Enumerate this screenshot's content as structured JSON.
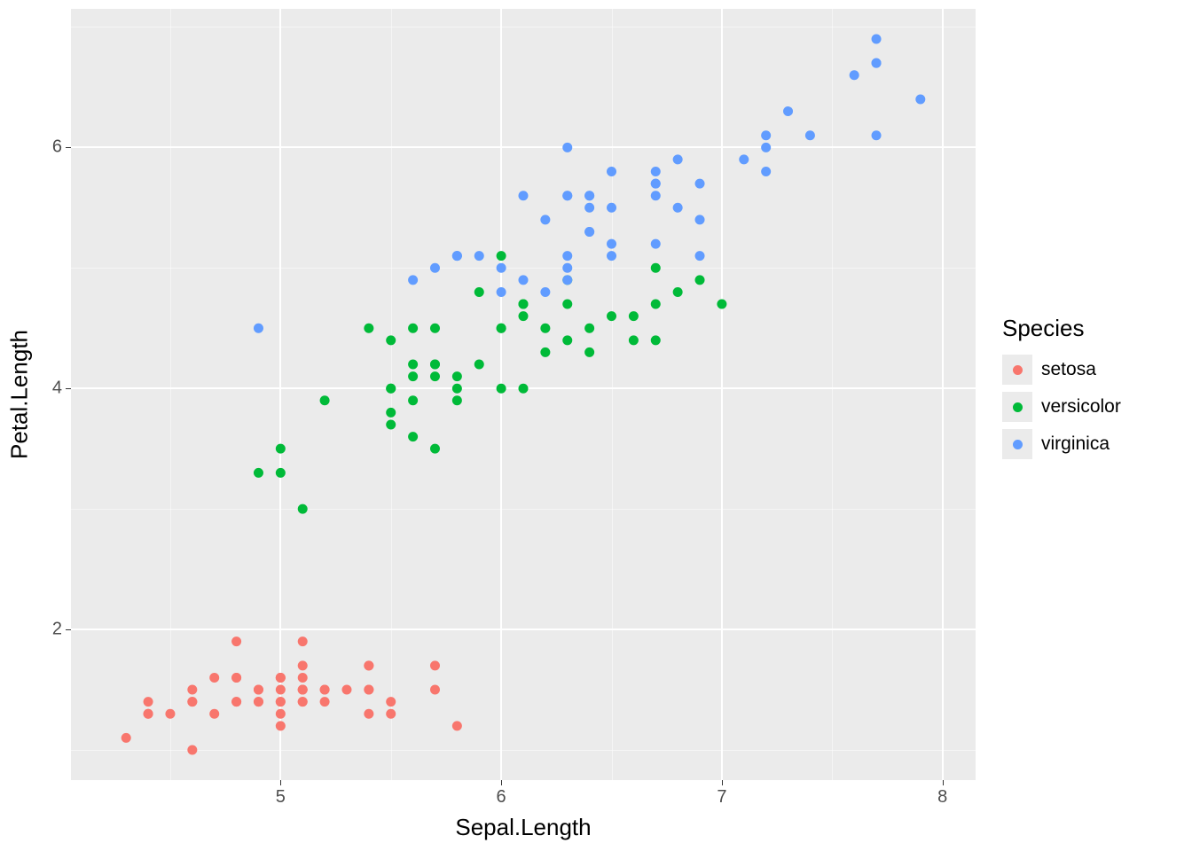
{
  "chart_data": {
    "type": "scatter",
    "xlabel": "Sepal.Length",
    "ylabel": "Petal.Length",
    "xlim": [
      4.05,
      8.15
    ],
    "ylim": [
      0.75,
      7.15
    ],
    "x_breaks": [
      5,
      6,
      7,
      8
    ],
    "y_breaks": [
      2,
      4,
      6
    ],
    "x_minor": [
      4.5,
      5.5,
      6.5,
      7.5
    ],
    "y_minor": [
      1,
      3,
      5,
      7
    ],
    "legend_title": "Species",
    "series": [
      {
        "name": "setosa",
        "color": "#F8766D",
        "points": [
          [
            5.1,
            1.4
          ],
          [
            4.9,
            1.4
          ],
          [
            4.7,
            1.3
          ],
          [
            4.6,
            1.5
          ],
          [
            5.0,
            1.4
          ],
          [
            5.4,
            1.7
          ],
          [
            4.6,
            1.4
          ],
          [
            5.0,
            1.5
          ],
          [
            4.4,
            1.4
          ],
          [
            4.9,
            1.5
          ],
          [
            5.4,
            1.5
          ],
          [
            4.8,
            1.6
          ],
          [
            4.8,
            1.4
          ],
          [
            4.3,
            1.1
          ],
          [
            5.8,
            1.2
          ],
          [
            5.7,
            1.5
          ],
          [
            5.4,
            1.3
          ],
          [
            5.1,
            1.4
          ],
          [
            5.7,
            1.7
          ],
          [
            5.1,
            1.5
          ],
          [
            5.4,
            1.7
          ],
          [
            5.1,
            1.5
          ],
          [
            4.6,
            1.0
          ],
          [
            5.1,
            1.7
          ],
          [
            4.8,
            1.9
          ],
          [
            5.0,
            1.6
          ],
          [
            5.0,
            1.6
          ],
          [
            5.2,
            1.5
          ],
          [
            5.2,
            1.4
          ],
          [
            4.7,
            1.6
          ],
          [
            4.8,
            1.6
          ],
          [
            5.4,
            1.5
          ],
          [
            5.2,
            1.5
          ],
          [
            5.5,
            1.4
          ],
          [
            4.9,
            1.5
          ],
          [
            5.0,
            1.2
          ],
          [
            5.5,
            1.3
          ],
          [
            4.9,
            1.4
          ],
          [
            4.4,
            1.3
          ],
          [
            5.1,
            1.5
          ],
          [
            5.0,
            1.3
          ],
          [
            4.5,
            1.3
          ],
          [
            4.4,
            1.3
          ],
          [
            5.0,
            1.6
          ],
          [
            5.1,
            1.9
          ],
          [
            4.8,
            1.4
          ],
          [
            5.1,
            1.6
          ],
          [
            4.6,
            1.4
          ],
          [
            5.3,
            1.5
          ],
          [
            5.0,
            1.4
          ]
        ]
      },
      {
        "name": "versicolor",
        "color": "#00BA38",
        "points": [
          [
            7.0,
            4.7
          ],
          [
            6.4,
            4.5
          ],
          [
            6.9,
            4.9
          ],
          [
            5.5,
            4.0
          ],
          [
            6.5,
            4.6
          ],
          [
            5.7,
            4.5
          ],
          [
            6.3,
            4.7
          ],
          [
            4.9,
            3.3
          ],
          [
            6.6,
            4.6
          ],
          [
            5.2,
            3.9
          ],
          [
            5.0,
            3.5
          ],
          [
            5.9,
            4.2
          ],
          [
            6.0,
            4.0
          ],
          [
            6.1,
            4.7
          ],
          [
            5.6,
            3.6
          ],
          [
            6.7,
            4.4
          ],
          [
            5.6,
            4.5
          ],
          [
            5.8,
            4.1
          ],
          [
            6.2,
            4.5
          ],
          [
            5.6,
            3.9
          ],
          [
            5.9,
            4.8
          ],
          [
            6.1,
            4.0
          ],
          [
            6.3,
            4.9
          ],
          [
            6.1,
            4.7
          ],
          [
            6.4,
            4.3
          ],
          [
            6.6,
            4.4
          ],
          [
            6.8,
            4.8
          ],
          [
            6.7,
            5.0
          ],
          [
            6.0,
            4.5
          ],
          [
            5.7,
            3.5
          ],
          [
            5.5,
            3.8
          ],
          [
            5.5,
            3.7
          ],
          [
            5.8,
            3.9
          ],
          [
            6.0,
            5.1
          ],
          [
            5.4,
            4.5
          ],
          [
            6.0,
            4.5
          ],
          [
            6.7,
            4.7
          ],
          [
            6.3,
            4.4
          ],
          [
            5.6,
            4.1
          ],
          [
            5.5,
            4.0
          ],
          [
            5.5,
            4.4
          ],
          [
            6.1,
            4.6
          ],
          [
            5.8,
            4.0
          ],
          [
            5.0,
            3.3
          ],
          [
            5.6,
            4.2
          ],
          [
            5.7,
            4.2
          ],
          [
            5.7,
            4.2
          ],
          [
            6.2,
            4.3
          ],
          [
            5.1,
            3.0
          ],
          [
            5.7,
            4.1
          ]
        ]
      },
      {
        "name": "virginica",
        "color": "#619CFF",
        "points": [
          [
            6.3,
            6.0
          ],
          [
            5.8,
            5.1
          ],
          [
            7.1,
            5.9
          ],
          [
            6.3,
            5.6
          ],
          [
            6.5,
            5.8
          ],
          [
            7.6,
            6.6
          ],
          [
            4.9,
            4.5
          ],
          [
            7.3,
            6.3
          ],
          [
            6.7,
            5.8
          ],
          [
            7.2,
            6.1
          ],
          [
            6.5,
            5.1
          ],
          [
            6.4,
            5.3
          ],
          [
            6.8,
            5.5
          ],
          [
            5.7,
            5.0
          ],
          [
            5.8,
            5.1
          ],
          [
            6.4,
            5.3
          ],
          [
            6.5,
            5.5
          ],
          [
            7.7,
            6.7
          ],
          [
            7.7,
            6.9
          ],
          [
            6.0,
            5.0
          ],
          [
            6.9,
            5.7
          ],
          [
            5.6,
            4.9
          ],
          [
            7.7,
            6.7
          ],
          [
            6.3,
            4.9
          ],
          [
            6.7,
            5.7
          ],
          [
            7.2,
            6.0
          ],
          [
            6.2,
            4.8
          ],
          [
            6.1,
            4.9
          ],
          [
            6.4,
            5.6
          ],
          [
            7.2,
            5.8
          ],
          [
            7.4,
            6.1
          ],
          [
            7.9,
            6.4
          ],
          [
            6.4,
            5.6
          ],
          [
            6.3,
            5.1
          ],
          [
            6.1,
            5.6
          ],
          [
            7.7,
            6.1
          ],
          [
            6.3,
            5.6
          ],
          [
            6.4,
            5.5
          ],
          [
            6.0,
            4.8
          ],
          [
            6.9,
            5.4
          ],
          [
            6.7,
            5.6
          ],
          [
            6.9,
            5.1
          ],
          [
            5.8,
            5.1
          ],
          [
            6.8,
            5.9
          ],
          [
            6.7,
            5.7
          ],
          [
            6.7,
            5.2
          ],
          [
            6.3,
            5.0
          ],
          [
            6.5,
            5.2
          ],
          [
            6.2,
            5.4
          ],
          [
            5.9,
            5.1
          ]
        ]
      }
    ]
  }
}
